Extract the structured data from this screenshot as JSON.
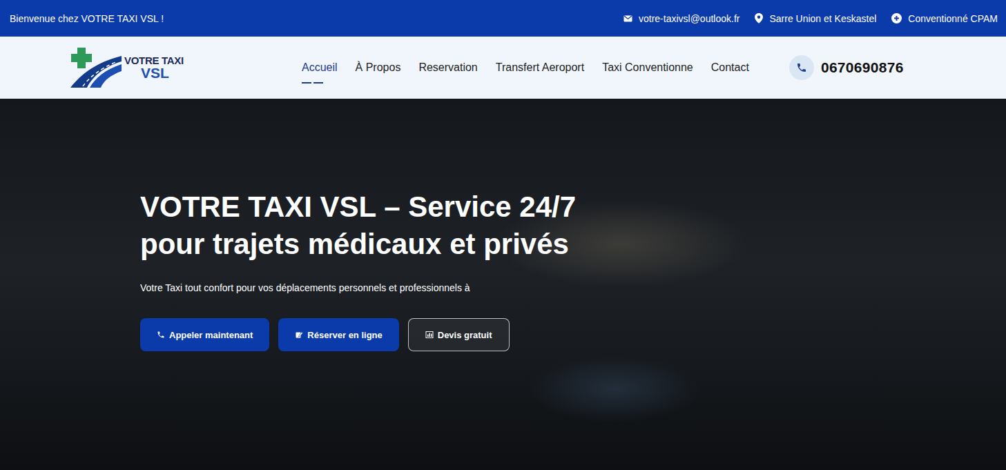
{
  "topbar": {
    "welcome": "Bienvenue chez VOTRE TAXI VSL !",
    "email": "votre-taxivsl@outlook.fr",
    "location": "Sarre Union et Keskastel",
    "badge": "Conventionné CPAM"
  },
  "logo": {
    "line1": "VOTRE TAXI",
    "line2": "VSL"
  },
  "nav": [
    {
      "label": "Accueil",
      "selected": true
    },
    {
      "label": "À Propos",
      "selected": false
    },
    {
      "label": "Reservation",
      "selected": false
    },
    {
      "label": "Transfert Aeroport",
      "selected": false
    },
    {
      "label": "Taxi Conventionne",
      "selected": false
    },
    {
      "label": "Contact",
      "selected": false
    }
  ],
  "phone": "0670690876",
  "hero": {
    "title": "VOTRE TAXI VSL – Service 24/7 pour trajets médicaux et privés",
    "subtitle": "Votre Taxi tout confort pour vos déplacements personnels et professionnels à",
    "buttons": [
      {
        "label": "Appeler maintenant",
        "kind": "primary"
      },
      {
        "label": "Réserver en ligne",
        "kind": "primary"
      },
      {
        "label": "Devis gratuit",
        "kind": "outline"
      }
    ]
  }
}
